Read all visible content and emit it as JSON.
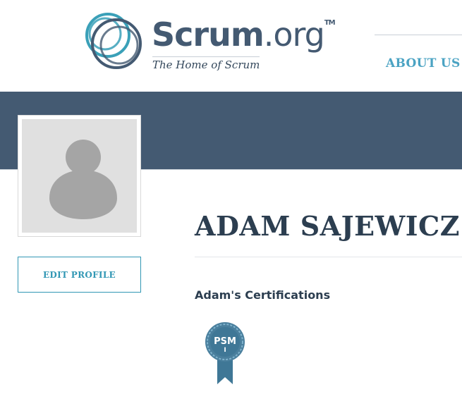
{
  "header": {
    "logo": {
      "word_main": "Scrum",
      "word_suffix": ".org",
      "trademark": "TM",
      "tagline": "The Home of Scrum"
    },
    "nav": {
      "about_label": "ABOUT US"
    }
  },
  "profile": {
    "name": "ADAM SAJEWICZ",
    "edit_label": "EDIT PROFILE",
    "certifications_heading": "Adam's Certifications",
    "certifications": [
      {
        "acronym": "PSM",
        "level": "I"
      }
    ]
  },
  "colors": {
    "banner": "#445a72",
    "accent": "#4ba3c3",
    "button": "#3197b4",
    "name_text": "#2c3e50",
    "badge": "#3f7796"
  }
}
